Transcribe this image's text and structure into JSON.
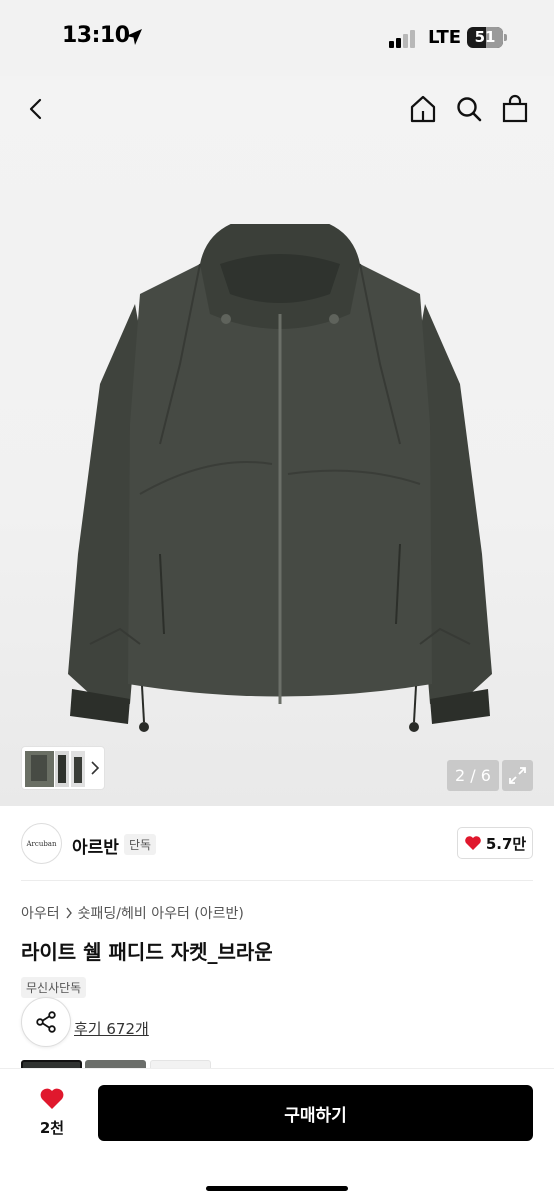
{
  "status_bar": {
    "time": "13:10",
    "network": "LTE",
    "battery": "51"
  },
  "top_nav": {
    "back_icon": "chevron-left-icon",
    "home_icon": "home-icon",
    "search_icon": "search-icon",
    "bag_icon": "shopping-bag-icon"
  },
  "gallery": {
    "counter": "2 / 6",
    "thumbnail_chevron_icon": "chevron-right-icon",
    "expand_icon": "expand-icon"
  },
  "brand": {
    "logo_text": "Arcuban",
    "name": "아르반",
    "exclusive_tag": "단독",
    "like_count": "5.7만",
    "heart_color": "#e0182d"
  },
  "breadcrumb": {
    "level1": "아우터",
    "level2": "숏패딩/헤비 아우터 (아르반)"
  },
  "product": {
    "title": "라이트 쉘 패디드 자켓_브라운",
    "badge": "무신사단독",
    "review_link": "후기 672개"
  },
  "bottom_bar": {
    "wish_count": "2천",
    "buy_label": "구매하기"
  }
}
